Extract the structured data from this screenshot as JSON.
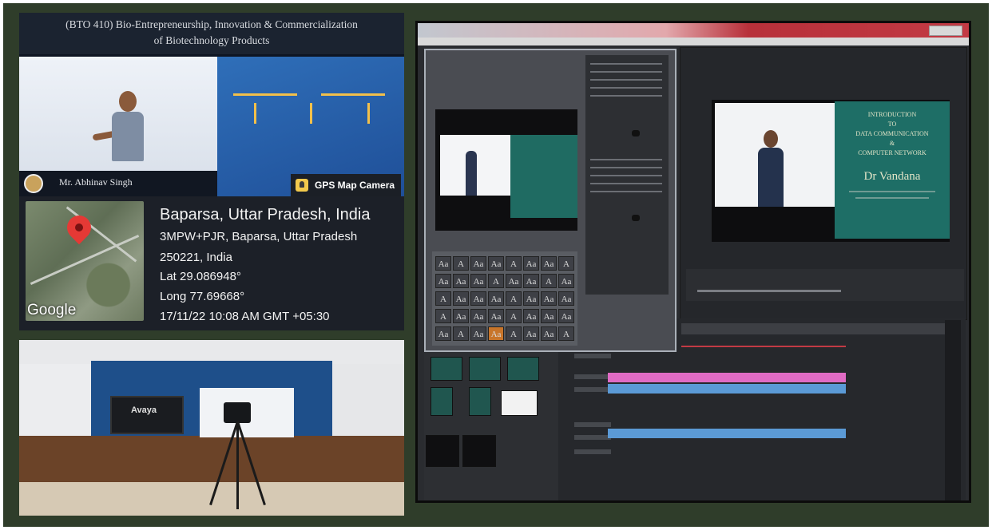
{
  "lecture": {
    "course_line1": "(BTO 410) Bio-Entrepreneurship, Innovation & Commercialization",
    "course_line2": "of Biotechnology Products",
    "presenter": "Mr. Abhinav Singh",
    "gps_badge": "GPS Map Camera"
  },
  "geotag": {
    "place": "Baparsa, Uttar Pradesh, India",
    "address_line1": "3MPW+PJR, Baparsa, Uttar Pradesh",
    "address_line2": "250221, India",
    "lat": "Lat 29.086948°",
    "long": "Long 77.69668°",
    "timestamp": "17/11/22 10:08 AM GMT +05:30",
    "map_provider": "Google"
  },
  "studio": {
    "tv_brand": "Avaya"
  },
  "editor": {
    "slide_line1": "INTRODUCTION",
    "slide_line2": "TO",
    "slide_line3": "DATA COMMUNICATION",
    "slide_line4": "&",
    "slide_line5": "COMPUTER NETWORK",
    "slide_author": "Dr Vandana"
  },
  "icons": {
    "map_pin": "map-pin-icon",
    "gps_camera": "gps-camera-icon",
    "video_camera": "video-camera-icon"
  },
  "colors": {
    "frame": "#2f3d2a",
    "pin": "#e53935",
    "slide_green": "#1e6e66",
    "clip_pink": "#e06bc4",
    "clip_blue": "#5b9ad6",
    "titlebar_red": "#b8303a"
  }
}
